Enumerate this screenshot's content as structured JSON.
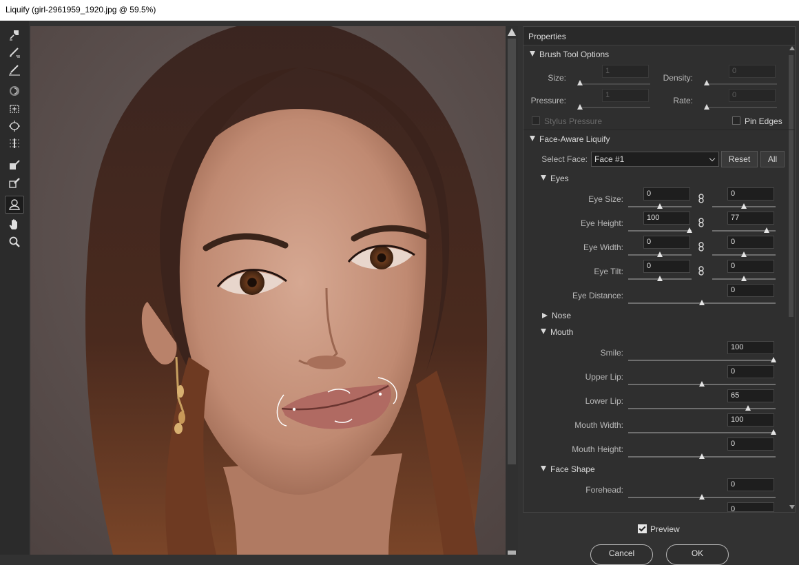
{
  "window": {
    "title": "Liquify (girl-2961959_1920.jpg @ 59.5%)"
  },
  "tools": [
    {
      "icon": "forward-warp-icon"
    },
    {
      "icon": "reconstruct-icon"
    },
    {
      "icon": "smooth-icon"
    },
    {
      "icon": "twirl-icon"
    },
    {
      "icon": "pucker-icon"
    },
    {
      "icon": "bloat-icon"
    },
    {
      "icon": "push-left-icon"
    },
    {
      "icon": "freeze-mask-icon"
    },
    {
      "icon": "thaw-mask-icon"
    },
    {
      "icon": "face-tool-icon",
      "active": true
    },
    {
      "icon": "hand-icon"
    },
    {
      "icon": "zoom-icon"
    }
  ],
  "properties": {
    "title": "Properties",
    "brush": {
      "heading": "Brush Tool Options",
      "size_label": "Size:",
      "size_value": "1",
      "density_label": "Density:",
      "density_value": "0",
      "pressure_label": "Pressure:",
      "pressure_value": "1",
      "rate_label": "Rate:",
      "rate_value": "0",
      "stylus_label": "Stylus Pressure",
      "pin_edges_label": "Pin Edges"
    },
    "face": {
      "heading": "Face-Aware Liquify",
      "select_label": "Select Face:",
      "select_value": "Face #1",
      "reset_label": "Reset",
      "all_label": "All",
      "eyes": {
        "heading": "Eyes",
        "size_label": "Eye Size:",
        "size_left": "0",
        "size_right": "0",
        "height_label": "Eye Height:",
        "height_left": "100",
        "height_right": "77",
        "width_label": "Eye Width:",
        "width_left": "0",
        "width_right": "0",
        "tilt_label": "Eye Tilt:",
        "tilt_left": "0",
        "tilt_right": "0",
        "distance_label": "Eye Distance:",
        "distance_value": "0"
      },
      "nose": {
        "heading": "Nose"
      },
      "mouth": {
        "heading": "Mouth",
        "smile_label": "Smile:",
        "smile_value": "100",
        "upper_label": "Upper Lip:",
        "upper_value": "0",
        "lower_label": "Lower Lip:",
        "lower_value": "65",
        "width_label": "Mouth Width:",
        "width_value": "100",
        "height_label": "Mouth Height:",
        "height_value": "0"
      },
      "shape": {
        "heading": "Face Shape",
        "forehead_label": "Forehead:",
        "forehead_value": "0",
        "chin_value": "0"
      }
    }
  },
  "footer": {
    "preview_label": "Preview",
    "cancel_label": "Cancel",
    "ok_label": "OK"
  },
  "colors": {
    "panel_bg": "#2f2f2f",
    "toolbar_bg": "#2b2b2b",
    "accent": "#e6e6e6"
  }
}
